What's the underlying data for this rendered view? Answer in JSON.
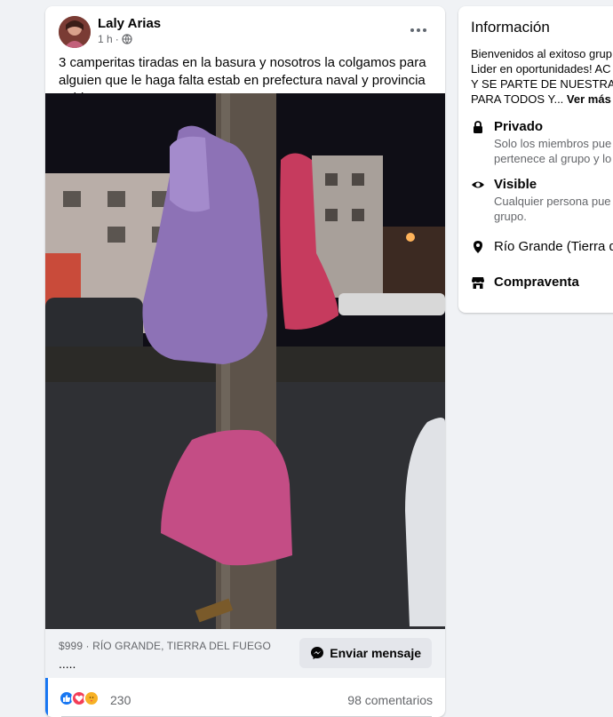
{
  "post": {
    "author": "Laly Arias",
    "time": "1 h",
    "visibility_icon": "globe-icon",
    "text": "3 camperitas tiradas en la basura y nosotros la colgamos para alguien que le haga falta estab en prefectura naval y provincia unida ....",
    "listing": {
      "price": "$999",
      "separator": " · ",
      "location": "RÍO GRANDE, TIERRA DEL FUEGO",
      "title": "....."
    },
    "message_button": "Enviar mensaje",
    "reaction_count": "230",
    "comments": "98 comentarios"
  },
  "info": {
    "title": "Información",
    "description_lines": [
      "Bienvenidos al exitoso grup",
      "Lider en oportunidades! AC",
      "Y SE PARTE DE NUESTRA CO",
      "PARA TODOS Y..."
    ],
    "see_more": "Ver más",
    "private_label": "Privado",
    "private_desc_lines": [
      "Solo los miembros pue",
      "pertenece al grupo y lo"
    ],
    "visible_label": "Visible",
    "visible_desc_lines": [
      "Cualquier persona pue",
      "grupo."
    ],
    "location": "Río Grande (Tierra d",
    "category": "Compraventa"
  },
  "colors": {
    "accent": "#1877f2",
    "secondary_text": "#65676b",
    "background": "#f0f2f5"
  }
}
